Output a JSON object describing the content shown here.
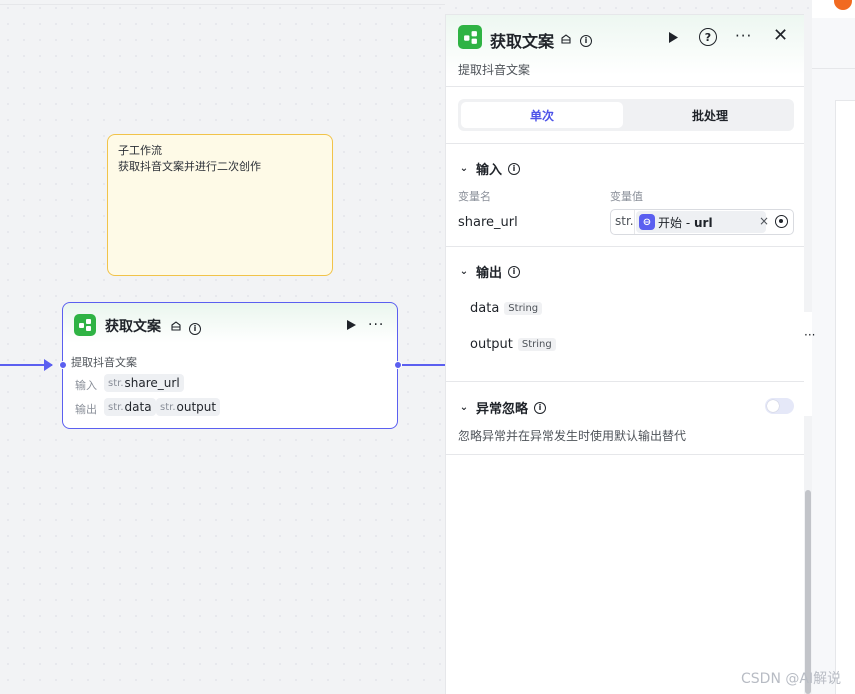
{
  "note": {
    "title": "子工作流",
    "body": "获取抖音文案并进行二次创作"
  },
  "node": {
    "title": "获取文案",
    "description": "提取抖音文案",
    "input_label": "输入",
    "output_label": "输出",
    "type_prefix": "str.",
    "inputs": [
      "share_url"
    ],
    "outputs": [
      "data",
      "output"
    ],
    "more_glyph": "···"
  },
  "panel": {
    "title": "获取文案",
    "description": "提取抖音文案",
    "help_glyph": "?",
    "more_glyph": "···",
    "close_glyph": "✕",
    "tabs": [
      {
        "label": "单次",
        "active": true
      },
      {
        "label": "批处理",
        "active": false
      }
    ],
    "input_section": {
      "title": "输入",
      "col_name": "变量名",
      "col_value": "变量值",
      "var_name": "share_url",
      "var_type": "str.",
      "ref_node": "开始",
      "ref_sep": " - ",
      "ref_var": "url",
      "clear_glyph": "×"
    },
    "output_section": {
      "title": "输出",
      "items": [
        {
          "name": "data",
          "type": "String"
        },
        {
          "name": "output",
          "type": "String"
        }
      ]
    },
    "exception_section": {
      "title": "异常忽略",
      "description": "忽略异常并在异常发生时使用默认输出替代",
      "enabled": false
    }
  },
  "right_dots": "···",
  "watermark": "CSDN @AI解说",
  "colors": {
    "accent": "#5b5ff0",
    "node_icon": "#2fb344",
    "note_bg": "#fefae7",
    "note_border": "#f1c34a"
  }
}
